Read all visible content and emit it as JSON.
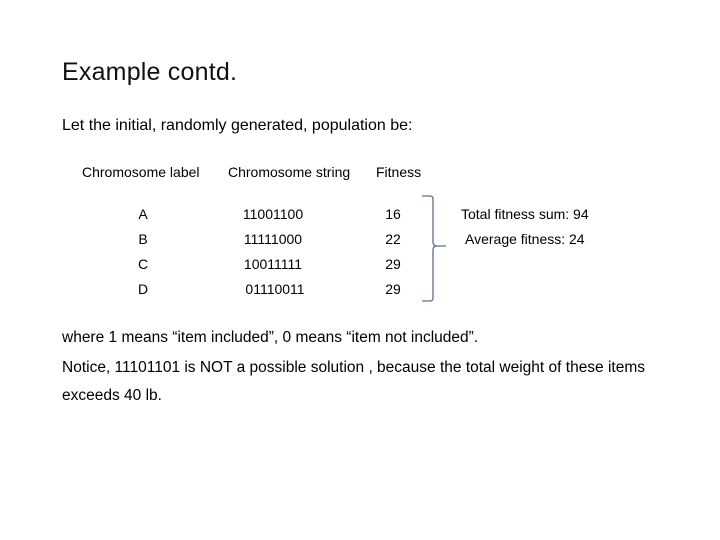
{
  "slide": {
    "title": "Example contd.",
    "intro": "Let the initial, randomly generated, population be:"
  },
  "table": {
    "headers": [
      "Chromosome label",
      "Chromosome string",
      "Fitness"
    ],
    "rows": [
      {
        "label": "A",
        "string": "11001100",
        "fitness": "16"
      },
      {
        "label": "B",
        "string": "11111000",
        "fitness": "22"
      },
      {
        "label": "C",
        "string": "10011111",
        "fitness": "29"
      },
      {
        "label": "D",
        "string": "01110011",
        "fitness": "29"
      }
    ]
  },
  "summary": {
    "total": "Total fitness sum: 94",
    "average": "Average fitness: 24"
  },
  "footnotes": [
    "where 1 means “item included”, 0 means “item not included”.",
    "Notice, 11101101 is NOT a possible solution , because the total weight of these items",
    "exceeds 40 lb."
  ],
  "colors": {
    "brace": "#5b7189"
  }
}
